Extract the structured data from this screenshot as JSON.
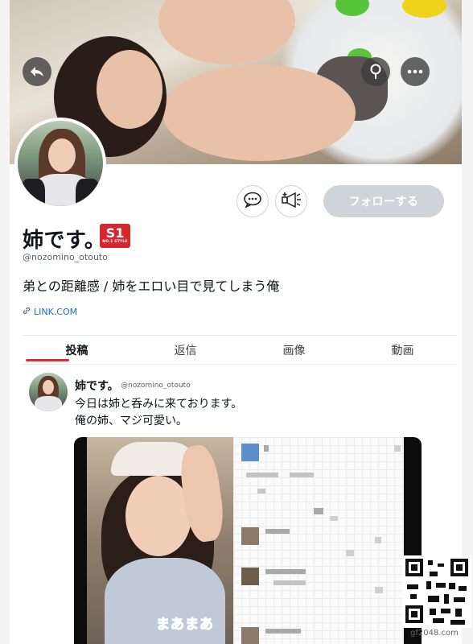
{
  "profile": {
    "display_name": "姉です。",
    "handle": "@nozomino_otouto",
    "bio": "弟との距離感 / 姉をエロい目で見てしまう俺",
    "link_text": "LINK.COM",
    "badge": {
      "big": "S1",
      "small": "NO.1 STYLE",
      "color": "#d7262e"
    }
  },
  "header": {
    "back_icon": "back-arrow-icon",
    "search_icon": "search-icon",
    "more_icon": "more-dots-icon"
  },
  "actions": {
    "message_icon": "chat-bubble-icon",
    "notify_icon": "megaphone-icon",
    "follow_label": "フォローする"
  },
  "tabs": [
    {
      "label": "投稿",
      "active": true
    },
    {
      "label": "返信",
      "active": false
    },
    {
      "label": "画像",
      "active": false
    },
    {
      "label": "動画",
      "active": false
    }
  ],
  "post": {
    "name": "姉です。",
    "handle": "@nozomino_otouto",
    "lines": [
      "今日は姉と呑みに来ております。",
      "俺の姉、マジ可愛い。"
    ],
    "media_caption": "まあまあ"
  },
  "watermark": "gf2048.com",
  "colors": {
    "accent": "#e3233a",
    "follow_bg": "#d0d4d8",
    "link": "#1d6fb8"
  }
}
